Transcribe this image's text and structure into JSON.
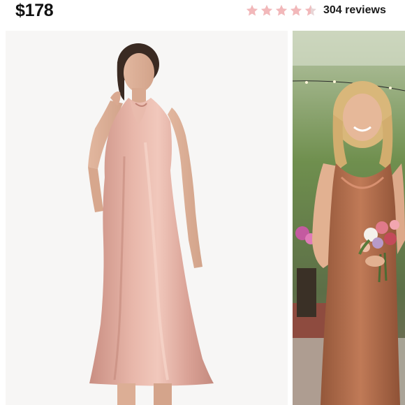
{
  "product": {
    "price": "$178",
    "rating": {
      "value": 4.5,
      "max": 5,
      "star_color": "#f2b8ba",
      "star_empty_color": "#e8d5d6"
    },
    "reviews_label": "304 reviews"
  },
  "gallery": {
    "images": [
      {
        "subject": "model in blush satin halter midi dress",
        "dress_color": "#d9a195"
      },
      {
        "subject": "bridesmaid in copper cowl-neck slip dress holding bouquet",
        "dress_color": "#b06e4e"
      }
    ]
  },
  "colors": {
    "text": "#111111",
    "background": "#ffffff"
  }
}
